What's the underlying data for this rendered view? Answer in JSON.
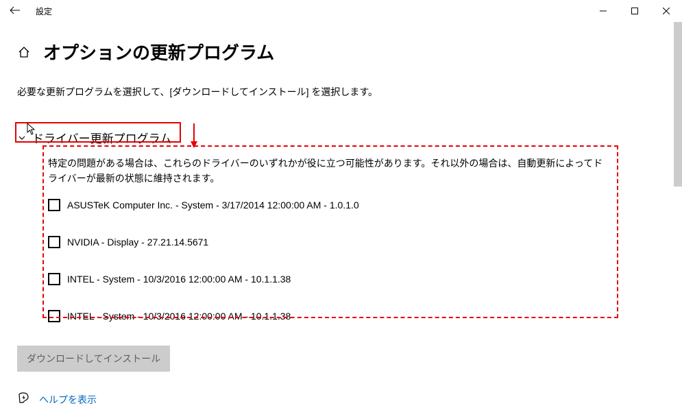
{
  "window": {
    "title": "設定"
  },
  "page": {
    "heading": "オプションの更新プログラム",
    "description": "必要な更新プログラムを選択して、[ダウンロードしてインストール] を選択します。"
  },
  "section": {
    "title": "ドライバー更新プログラム",
    "info": "特定の問題がある場合は、これらのドライバーのいずれかが役に立つ可能性があります。それ以外の場合は、自動更新によってドライバーが最新の状態に維持されます。"
  },
  "drivers": [
    {
      "label": "ASUSTeK Computer Inc. - System - 3/17/2014 12:00:00 AM - 1.0.1.0"
    },
    {
      "label": "NVIDIA - Display - 27.21.14.5671"
    },
    {
      "label": "INTEL - System - 10/3/2016 12:00:00 AM - 10.1.1.38"
    },
    {
      "label": "INTEL - System - 10/3/2016 12:00:00 AM - 10.1.1.38"
    }
  ],
  "actions": {
    "download": "ダウンロードしてインストール",
    "help": "ヘルプを表示"
  }
}
